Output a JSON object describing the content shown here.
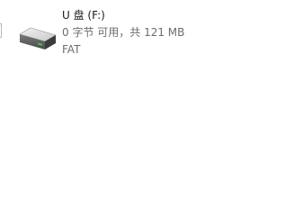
{
  "drive": {
    "name": "U 盘 (F:)",
    "space": "0 字节 可用，共 121 MB",
    "filesystem": "FAT",
    "icon": "removable-drive-icon",
    "accent_color": "#3ecf3e"
  }
}
